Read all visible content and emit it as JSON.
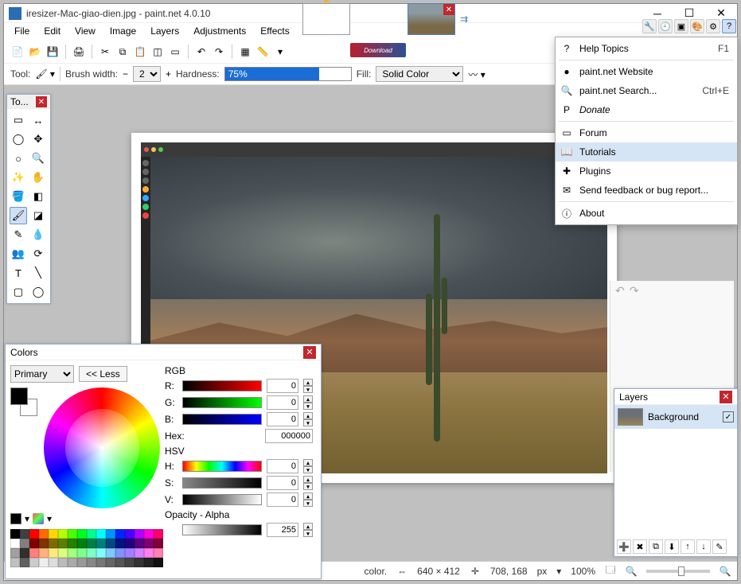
{
  "title": "iresizer-Mac-giao-dien.jpg - paint.net 4.0.10",
  "menus": [
    "File",
    "Edit",
    "View",
    "Image",
    "Layers",
    "Adjustments",
    "Effects"
  ],
  "options": {
    "tool_label": "Tool:",
    "brush_label": "Brush width:",
    "brush_value": "2",
    "hardness_label": "Hardness:",
    "hardness_pct": "75%",
    "fill_label": "Fill:",
    "fill_value": "Solid Color"
  },
  "tools_title": "To...",
  "help_menu": {
    "items": [
      {
        "icon": "?",
        "label": "Help Topics",
        "shortcut": "F1"
      },
      {
        "icon": "●",
        "label": "paint.net Website"
      },
      {
        "icon": "🔍",
        "label": "paint.net Search...",
        "shortcut": "Ctrl+E"
      },
      {
        "icon": "P",
        "label": "Donate",
        "italic": true
      },
      {
        "icon": "▭",
        "label": "Forum"
      },
      {
        "icon": "📖",
        "label": "Tutorials",
        "hover": true
      },
      {
        "icon": "✚",
        "label": "Plugins"
      },
      {
        "icon": "✉",
        "label": "Send feedback or bug report..."
      },
      {
        "icon": "ⓘ",
        "label": "About"
      }
    ]
  },
  "colors": {
    "title": "Colors",
    "primary_label": "Primary",
    "less_btn": "<< Less",
    "rgb": "RGB",
    "r": "R:",
    "g": "G:",
    "b": "B:",
    "r_val": "0",
    "g_val": "0",
    "b_val": "0",
    "hex_label": "Hex:",
    "hex_val": "000000",
    "hsv": "HSV",
    "h": "H:",
    "s": "S:",
    "v": "V:",
    "h_val": "0",
    "s_val": "0",
    "v_val": "0",
    "opacity_label": "Opacity - Alpha",
    "opacity_val": "255"
  },
  "layers": {
    "title": "Layers",
    "bg": "Background"
  },
  "status": {
    "color_label": "color.",
    "dims": "640 × 412",
    "pos": "708, 168",
    "unit": "px",
    "zoom": "100%"
  },
  "download_tag": "Download",
  "palette": [
    "#000",
    "#404040",
    "#ff0000",
    "#ff6a00",
    "#ffd800",
    "#b6ff00",
    "#4cff00",
    "#00ff21",
    "#00ff90",
    "#00ffff",
    "#0094ff",
    "#0026ff",
    "#4800ff",
    "#b200ff",
    "#ff00dc",
    "#ff006e",
    "#fff",
    "#808080",
    "#7f0000",
    "#7f3300",
    "#7f6a00",
    "#5b7f00",
    "#267f00",
    "#007f0e",
    "#007f46",
    "#007f7f",
    "#004a7f",
    "#00137f",
    "#21007f",
    "#57007f",
    "#7f006e",
    "#7f0037",
    "#a0a0a0",
    "#303030",
    "#ff7f7f",
    "#ffb27f",
    "#ffe97f",
    "#daff7f",
    "#a5ff7f",
    "#7fff8e",
    "#7fffc5",
    "#7fffff",
    "#7fc9ff",
    "#7f92ff",
    "#a17fff",
    "#d67fff",
    "#ff7fed",
    "#ff7fb6",
    "#c0c0c0",
    "#606060",
    "#ccc",
    "#eee",
    "#ddd",
    "#bbb",
    "#aaa",
    "#999",
    "#888",
    "#777",
    "#666",
    "#555",
    "#444",
    "#333",
    "#222",
    "#111"
  ]
}
